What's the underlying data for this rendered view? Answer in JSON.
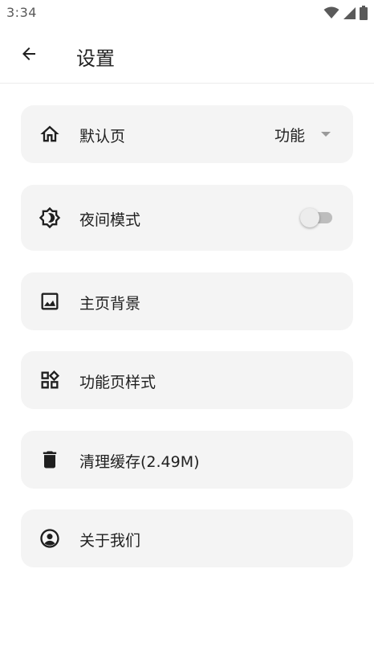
{
  "status_bar": {
    "time": "3:34",
    "icons": [
      "wifi-icon",
      "cell-signal-icon",
      "battery-icon"
    ]
  },
  "app_bar": {
    "back_icon": "arrow-back-icon",
    "title": "设置"
  },
  "settings": {
    "default_page": {
      "icon": "home-icon",
      "label": "默认页",
      "value": "功能"
    },
    "night_mode": {
      "icon": "brightness-icon",
      "label": "夜间模式",
      "enabled": false
    },
    "home_background": {
      "icon": "image-icon",
      "label": "主页背景"
    },
    "feature_page_style": {
      "icon": "widgets-icon",
      "label": "功能页样式"
    },
    "clear_cache": {
      "icon": "trash-icon",
      "label": "清理缓存(2.49M)"
    },
    "about_us": {
      "icon": "account-circle-icon",
      "label": "关于我们"
    }
  },
  "colors": {
    "card_background": "#f4f4f4",
    "text_primary": "#1f1f1f",
    "status_text": "#5a5a5a",
    "toggle_off_track": "#bdbdbd",
    "toggle_off_thumb": "#ececec"
  }
}
